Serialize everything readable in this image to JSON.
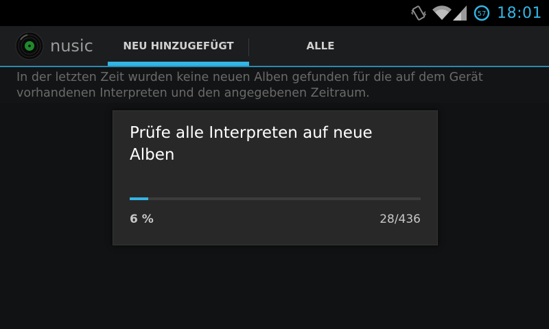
{
  "status_bar": {
    "time": "18:01",
    "battery_level": "57",
    "icons": [
      "vibrate-icon",
      "wifi-icon",
      "signal-icon",
      "battery-icon"
    ],
    "accent_color": "#33b5e5"
  },
  "app": {
    "title": "nusic",
    "logo_icon": "vinyl-record-icon"
  },
  "tabs": [
    {
      "label": "NEU HINZUGEFÜGT",
      "selected": true
    },
    {
      "label": "ALLE",
      "selected": false
    }
  ],
  "main": {
    "info_text": "In der letzten Zeit wurden keine neuen Alben gefunden für die auf dem Gerät vorhandenen Interpreten und den angegebenen Zeitraum."
  },
  "dialog": {
    "title": "Prüfe alle Interpreten auf neue Alben",
    "progress_percent_label": "6 %",
    "progress_count_label": "28/436",
    "progress_fraction": 0.064
  },
  "colors": {
    "accent": "#33b5e5",
    "background": "#131415",
    "dialog_background": "#282828"
  }
}
